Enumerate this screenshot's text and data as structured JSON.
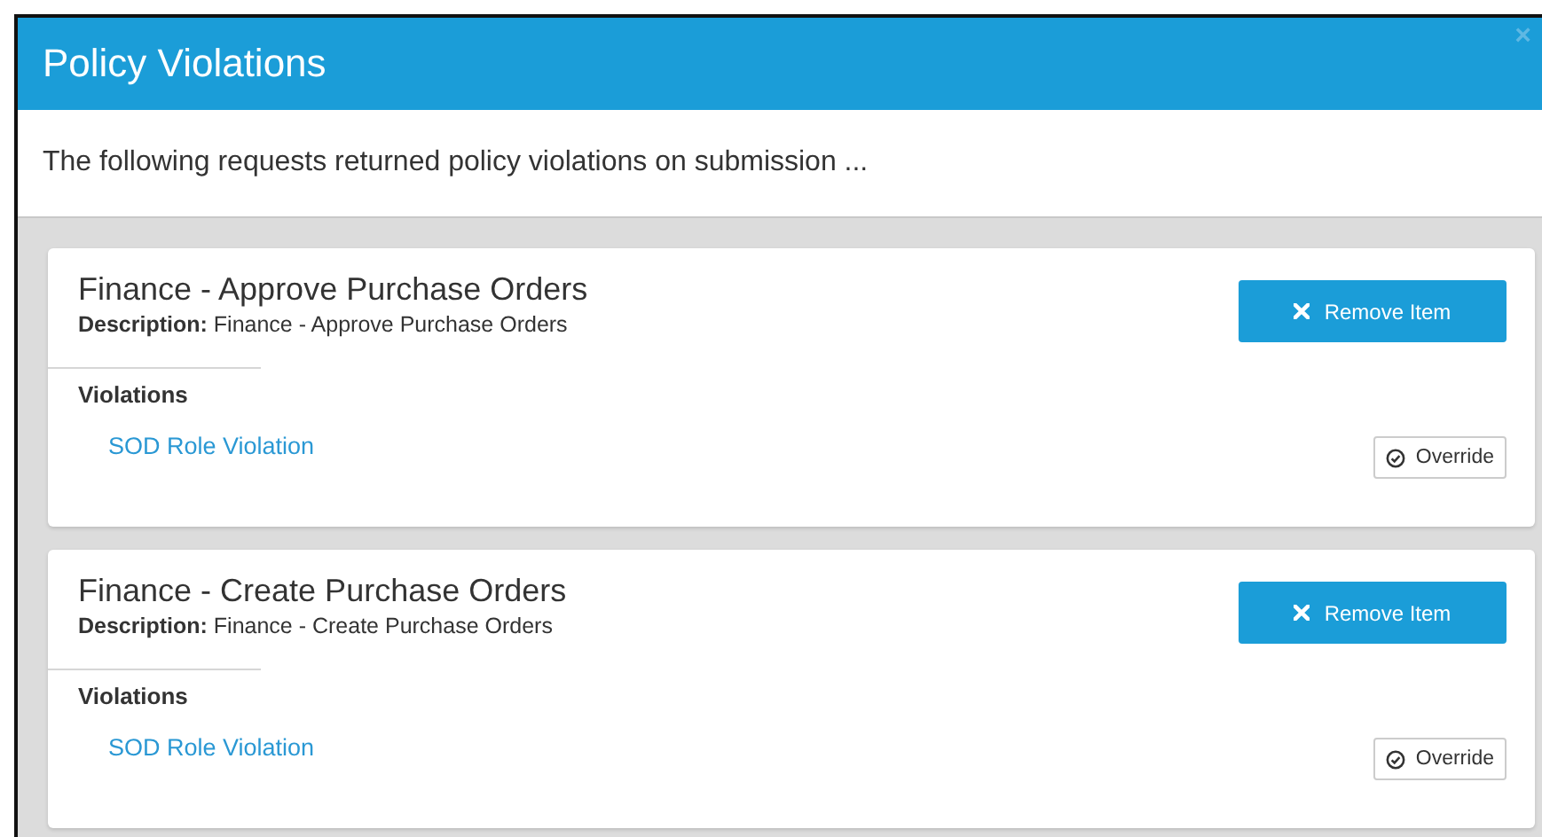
{
  "dialog": {
    "title": "Policy Violations",
    "close": "×",
    "intro": "The following requests returned policy violations on submission ..."
  },
  "items": [
    {
      "title": "Finance - Approve Purchase Orders",
      "description": "**Description:** Finance - Approve Purchase Orders",
      "remove_button": "Remove Item",
      "violations_heading": "Violations",
      "violations": [
        {
          "name": "SOD Role Violation",
          "override_button": "Override"
        }
      ]
    },
    {
      "title": "Finance - Create Purchase Orders",
      "description": "**Description:** Finance - Create Purchase Orders",
      "remove_button": "Remove Item",
      "violations_heading": "Violations",
      "violations": [
        {
          "name": "SOD Role Violation",
          "override_button": "Override"
        }
      ]
    }
  ]
}
